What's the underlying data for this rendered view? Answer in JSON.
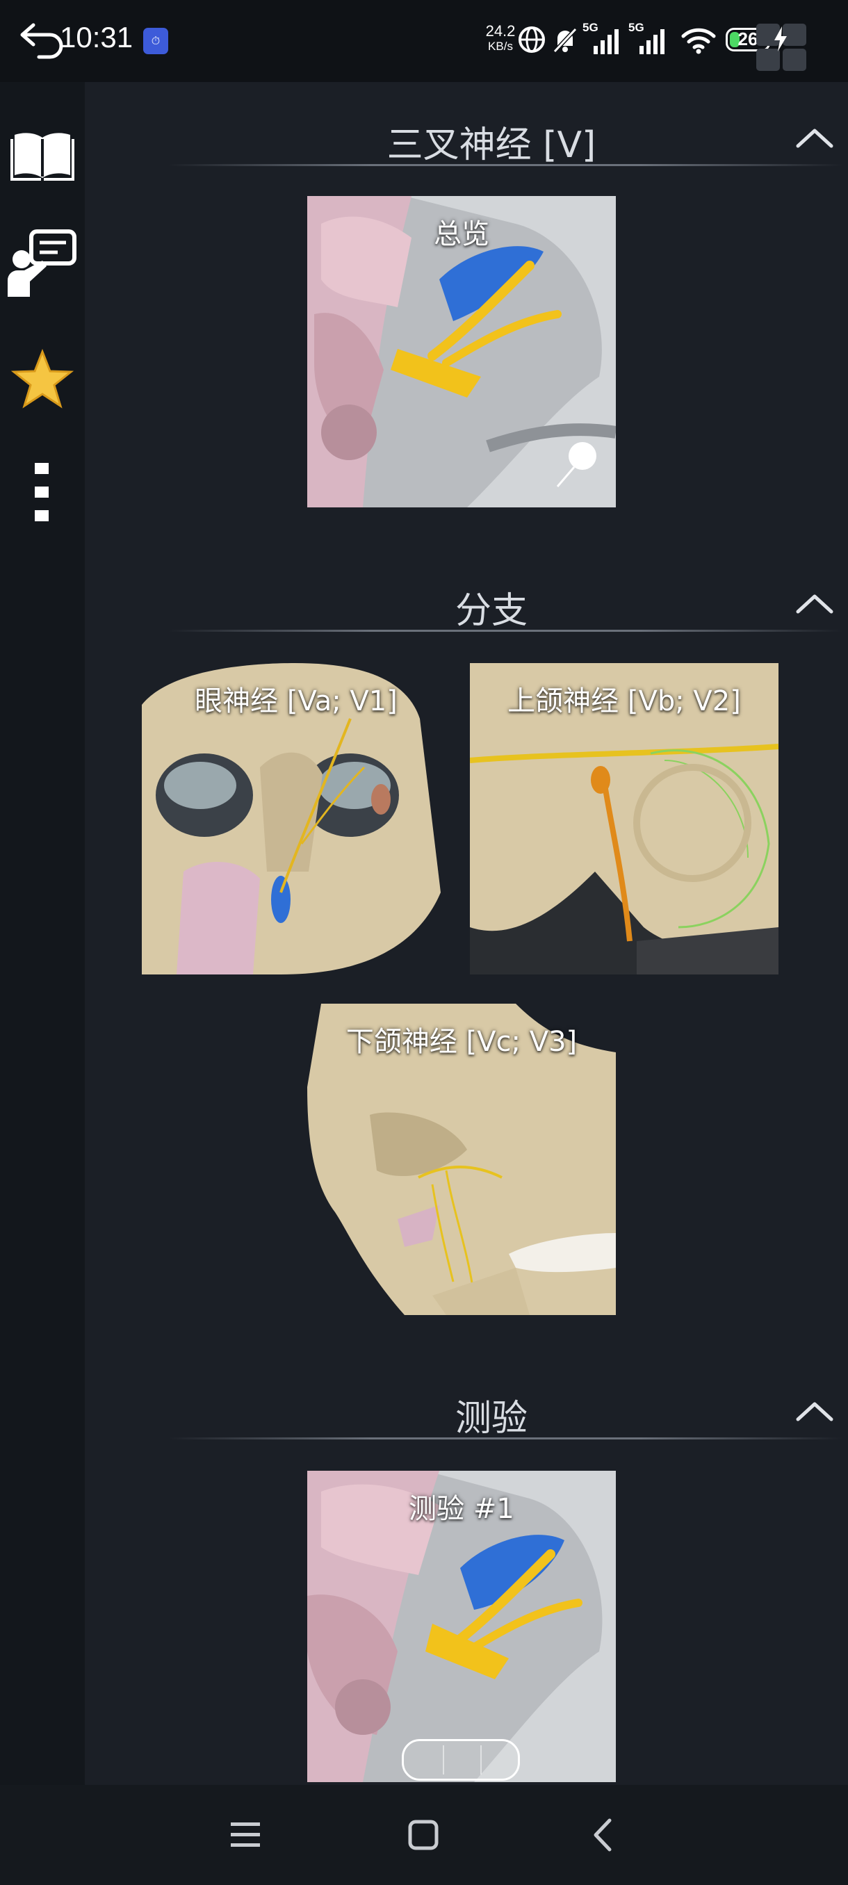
{
  "status_bar": {
    "time": "10:31",
    "network_speed_value": "24.2",
    "network_speed_unit": "KB/s",
    "signal_1": "5G",
    "signal_2": "5G",
    "battery": "26"
  },
  "sidebar": {
    "items": [
      {
        "name": "book-icon"
      },
      {
        "name": "presenter-icon"
      },
      {
        "name": "star-icon",
        "color": "#f5c542"
      },
      {
        "name": "more-vertical-icon"
      }
    ]
  },
  "sections": [
    {
      "title": "三叉神经 [V]",
      "tiles": [
        {
          "label": "总览"
        }
      ]
    },
    {
      "title": "分支",
      "tiles": [
        {
          "label": "眼神经 [Va; V1]"
        },
        {
          "label": "上颌神经 [Vb; V2]"
        },
        {
          "label": "下颌神经 [Vc; V3]"
        }
      ]
    },
    {
      "title": "测验",
      "tiles": [
        {
          "label": "测验 #1"
        }
      ]
    }
  ],
  "colors": {
    "background": "#1b1f26",
    "nerve_yellow": "#f2c21b",
    "ganglion_blue": "#2f6fd6",
    "bone": "#d8c9a6",
    "muscle_pink": "#d9b6c3"
  }
}
